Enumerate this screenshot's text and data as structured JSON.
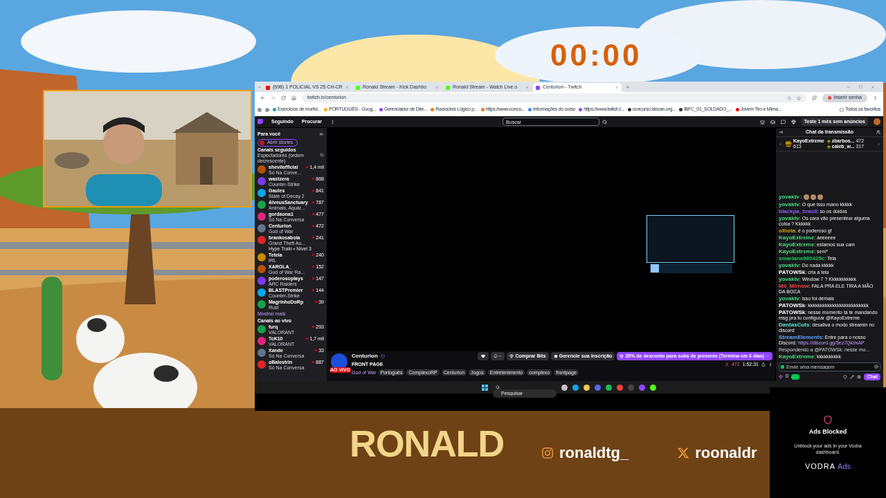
{
  "overlay": {
    "timer": "00:00",
    "brand": "RONALD",
    "socials": [
      {
        "kind": "instagram",
        "handle": "ronaldtg_"
      },
      {
        "kind": "x",
        "handle": "roonaldr"
      }
    ]
  },
  "ads_notice": {
    "title": "Ads Blocked",
    "body": "Unblock your ads in your Vodra dashboard.",
    "brand": "VODRA",
    "suffix": "Ads"
  },
  "browser": {
    "tabs": [
      {
        "title": "(698) 1 POLICIAL VS 25 CH-CR",
        "kind": "video",
        "selected": false
      },
      {
        "title": "Ronald Stream - Kick Dashbo",
        "kind": "kick",
        "selected": false
      },
      {
        "title": "Ronald Stream - Watch Live o",
        "kind": "kick",
        "selected": false
      },
      {
        "title": "Centurion - Twitch",
        "kind": "twitch",
        "selected": true
      }
    ],
    "url": "twitch.tv/centurion",
    "profile_button": "Inserir senha",
    "bookmarks": [
      {
        "title": "Exercícios de morfol...",
        "color": "#22a0b8"
      },
      {
        "title": "PORTUGUÊS - Goog...",
        "color": "#f4b400"
      },
      {
        "title": "Gerenciador de Dire...",
        "color": "#9146ff"
      },
      {
        "title": "Raciocínio Lógico p...",
        "color": "#f97316"
      },
      {
        "title": "https://www.concu...",
        "color": "#f97316"
      },
      {
        "title": "Informações do curso",
        "color": "#4285f4"
      },
      {
        "title": "https://www.twitch.t...",
        "color": "#9146ff"
      },
      {
        "title": "concurso.idecan.org...",
        "color": "#333333"
      },
      {
        "title": "IBFC_01_SOLDADO_...",
        "color": "#333333"
      },
      {
        "title": "Jovem Tiro e Mima...",
        "color": "#ff0000"
      }
    ],
    "all_bookmarks": "Todos os favoritos"
  },
  "twitch": {
    "nav": [
      "Seguindo",
      "Procurar"
    ],
    "search_placeholder": "Buscar",
    "promo": "Teste 1 mês sem anúncios"
  },
  "sidebar": {
    "title": "Para você",
    "stories": "Abrir stories",
    "followed_title": "Canais seguidos",
    "sort": "Espectadores (ordem decrescente)",
    "followed": [
      {
        "name": "shevilofficial",
        "game": "Só Na Conve...",
        "viewers": "1,4 mil"
      },
      {
        "name": "wastzera",
        "game": "Counter-Strike",
        "viewers": "868"
      },
      {
        "name": "Gaules",
        "game": "State of Decay 2",
        "viewers": "841"
      },
      {
        "name": "AlveusSanctuary",
        "game": "Animais, Aquár...",
        "viewers": "787"
      },
      {
        "name": "gordaona1",
        "game": "Só Na Conversa",
        "viewers": "477"
      },
      {
        "name": "Centurion",
        "game": "God of War",
        "viewers": "472"
      },
      {
        "name": "brankosaboia",
        "game": "Grand Theft Au...",
        "viewers": "241",
        "note": "Hype Train • Nível 3"
      },
      {
        "name": "Tetela",
        "game": "IRL",
        "viewers": "240"
      },
      {
        "name": "XAROLA_",
        "game": "God of War Ra...",
        "viewers": "152"
      },
      {
        "name": "poderosoplays",
        "game": "ARC Raiders",
        "viewers": "147"
      },
      {
        "name": "BLASTPremier",
        "game": "Counter-Strike",
        "viewers": "144"
      },
      {
        "name": "MagrinhoDoRp",
        "game": "Rust",
        "viewers": "39"
      }
    ],
    "show_more": "Mostrar mais",
    "live_title": "Canais ao vivo",
    "live": [
      {
        "name": "furq",
        "game": "VALORANT",
        "viewers": "293"
      },
      {
        "name": "TcK10",
        "game": "VALORANT",
        "viewers": "1,7 mil"
      },
      {
        "name": "Xande",
        "game": "Só Na Conversa",
        "viewers": "33"
      },
      {
        "name": "oBalestrin",
        "game": "Só Na Conversa",
        "viewers": "887"
      }
    ]
  },
  "stream": {
    "channel": "Centurion",
    "title": "FRONT PAGE",
    "live_badge": "AO VIVO",
    "game": "God of War",
    "tags": [
      "Português",
      "ComplexoRP",
      "Centurion",
      "Jogos",
      "Entretenimento",
      "complexo",
      "frontpage"
    ],
    "bits_button": "Comprar Bits",
    "sub_button": "Gerencie sua inscrição",
    "gift_promo": "35% de desconto para subs de presente (Termina em 3 dias)",
    "viewers": "472",
    "uptime": "1:52:31"
  },
  "chat": {
    "title": "Chat da transmissão",
    "gifters": [
      {
        "name": "KayoExtreme",
        "count": "613"
      },
      {
        "name": "zbarbos...",
        "count": "472"
      },
      {
        "name": "caleb_w...",
        "count": "317"
      }
    ],
    "messages": [
      {
        "kind": "emote",
        "user": "yovaktv",
        "color": "#4ade80"
      },
      {
        "kind": "text",
        "user": "yovaktv",
        "color": "#4ade80",
        "text": "O que isso mano kkkkk"
      },
      {
        "kind": "text",
        "user": "blackpa_brasil",
        "color": "#8b5cf6",
        "text": "so os doidos"
      },
      {
        "kind": "text",
        "user": "yovaktv",
        "color": "#4ade80",
        "text": "Os cara vão presentear alguma coisa ? Kkkkkk"
      },
      {
        "kind": "text",
        "user": "olhota",
        "color": "#d4a017",
        "text": "é o poderoso gf"
      },
      {
        "kind": "text",
        "user": "KayoExtreme",
        "color": "#4ade80",
        "text": "aeeeeee"
      },
      {
        "kind": "text",
        "user": "KayoExtreme",
        "color": "#4ade80",
        "text": "estamos sua cam"
      },
      {
        "kind": "text",
        "user": "KayoExtreme",
        "color": "#4ade80",
        "text": "sem*"
      },
      {
        "kind": "text",
        "user": "smariana980425c",
        "color": "#22c55e",
        "text": "Tela"
      },
      {
        "kind": "text",
        "user": "yovaktv",
        "color": "#4ade80",
        "text": "Do nada kkkkk"
      },
      {
        "kind": "text",
        "user": "PATOWSk",
        "color": "#ffffff",
        "text": "cria a tela"
      },
      {
        "kind": "text",
        "user": "yovaktv",
        "color": "#4ade80",
        "text": "Window 7 ? Kkkkkkkkkkk"
      },
      {
        "kind": "text",
        "user": "Mil_Mirnow",
        "color": "#ef4444",
        "text": "FALA PRA ELE TIRA A MÃO DA BOCA"
      },
      {
        "kind": "text",
        "user": "yovaktv",
        "color": "#4ade80",
        "text": "isso foi demais"
      },
      {
        "kind": "text",
        "user": "PATOWSk",
        "color": "#ffffff",
        "text": "kkkkkkkkkkkkkkkkkkkkkkkkk"
      },
      {
        "kind": "text",
        "user": "PATOWSk",
        "color": "#ffffff",
        "text": "nesse momento tá te mandando msg pra tu configurar @KayoExtreme"
      },
      {
        "kind": "text",
        "user": "DantasCuts",
        "color": "#5eead4",
        "text": "desativa o modo streamin no discord"
      },
      {
        "kind": "text",
        "user": "StreamElements",
        "color": "#60a5fa",
        "text": "Entre para o nosso Discord:",
        "link": "https://discord.gg/5ez7Qk9xAP"
      },
      {
        "kind": "reply",
        "text": "Respondendo a @PATOWSk: nesse mo..."
      },
      {
        "kind": "text",
        "user": "KayoExtreme",
        "color": "#4ade80",
        "text": "kkkkkkkkkk"
      }
    ],
    "separator": ":",
    "input_placeholder": "Envie uma mensagem",
    "points": "0",
    "chat_button": "Chat"
  },
  "taskbar": {
    "search_placeholder": "Pesquisar"
  }
}
